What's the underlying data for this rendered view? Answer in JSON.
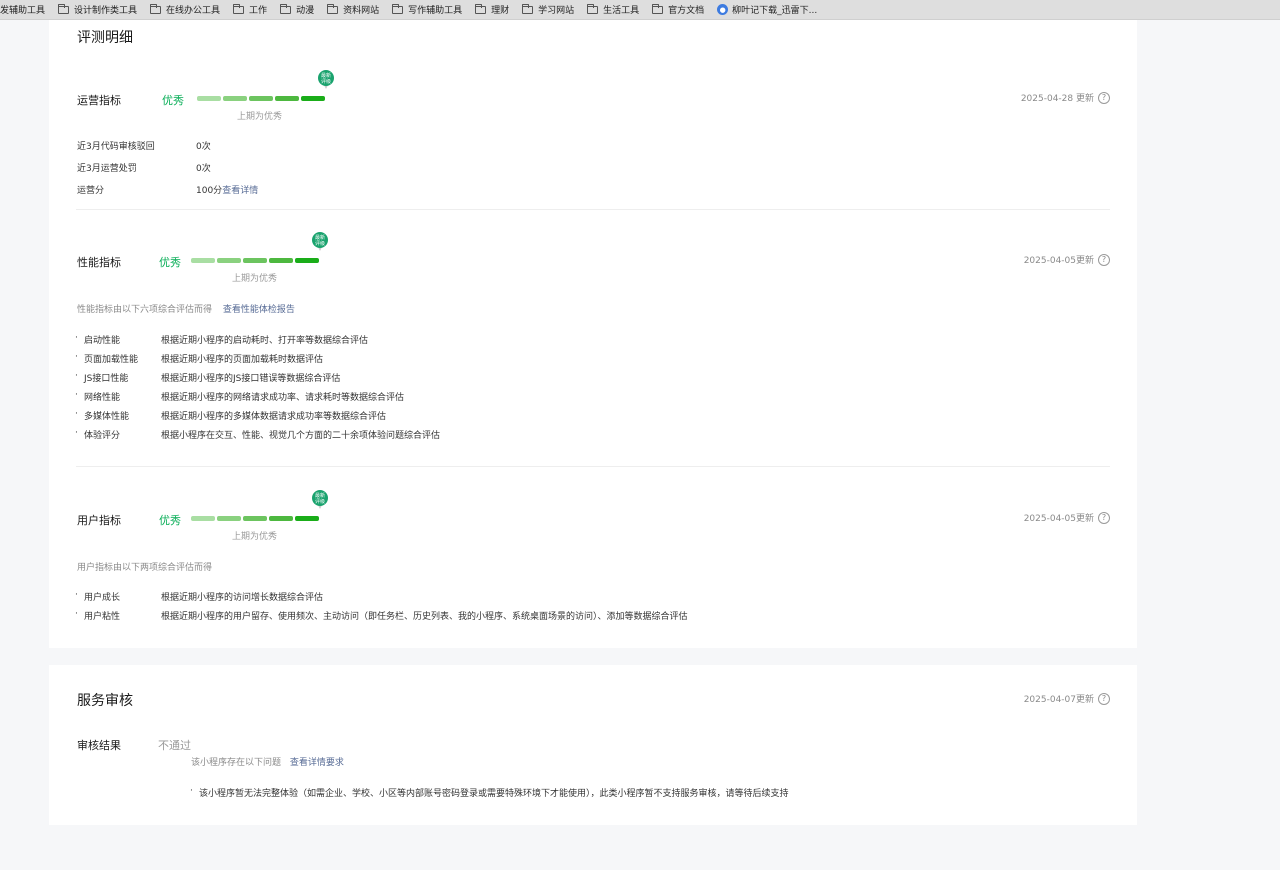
{
  "bookmarks": [
    {
      "label": "发辅助工具",
      "icon": "none"
    },
    {
      "label": "设计制作类工具",
      "icon": "folder-icon"
    },
    {
      "label": "在线办公工具",
      "icon": "folder-icon"
    },
    {
      "label": "工作",
      "icon": "folder-icon"
    },
    {
      "label": "动漫",
      "icon": "folder-icon"
    },
    {
      "label": "资料网站",
      "icon": "folder-icon"
    },
    {
      "label": "写作辅助工具",
      "icon": "folder-icon"
    },
    {
      "label": "理财",
      "icon": "folder-icon"
    },
    {
      "label": "学习网站",
      "icon": "folder-icon"
    },
    {
      "label": "生活工具",
      "icon": "folder-icon"
    },
    {
      "label": "官方文档",
      "icon": "folder-icon"
    },
    {
      "label": "柳叶记下载_迅雷下...",
      "icon": "site-icon"
    }
  ],
  "evaluation": {
    "title": "评测明细",
    "operations": {
      "label": "运营指标",
      "grade": "优秀",
      "progress_level": 5,
      "progress_max": 5,
      "previous": "上期为优秀",
      "updated": "2025-04-28 更新",
      "rows": [
        {
          "key": "近3月代码审核驳回",
          "value": "0次"
        },
        {
          "key": "近3月运营处罚",
          "value": "0次"
        },
        {
          "key": "运营分",
          "value": "100分",
          "link": "查看详情"
        }
      ]
    },
    "performance": {
      "label": "性能指标",
      "grade": "优秀",
      "progress_level": 5,
      "progress_max": 5,
      "previous": "上期为优秀",
      "updated": "2025-04-05更新",
      "description": "性能指标由以下六项综合评估而得",
      "report_link": "查看性能体检报告",
      "items": [
        {
          "name": "启动性能",
          "desc": "根据近期小程序的启动耗时、打开率等数据综合评估"
        },
        {
          "name": "页面加载性能",
          "desc": "根据近期小程序的页面加载耗时数据评估"
        },
        {
          "name": "JS接口性能",
          "desc": "根据近期小程序的JS接口错误等数据综合评估"
        },
        {
          "name": "网络性能",
          "desc": "根据近期小程序的网络请求成功率、请求耗时等数据综合评估"
        },
        {
          "name": "多媒体性能",
          "desc": "根据近期小程序的多媒体数据请求成功率等数据综合评估"
        },
        {
          "name": "体验评分",
          "desc": "根据小程序在交互、性能、视觉几个方面的二十余项体验问题综合评估"
        }
      ]
    },
    "user": {
      "label": "用户指标",
      "grade": "优秀",
      "progress_level": 5,
      "progress_max": 5,
      "previous": "上期为优秀",
      "updated": "2025-04-05更新",
      "description": "用户指标由以下两项综合评估而得",
      "items": [
        {
          "name": "用户成长",
          "desc": "根据近期小程序的访问增长数据综合评估"
        },
        {
          "name": "用户粘性",
          "desc": "根据近期小程序的用户留存、使用频次、主动访问（即任务栏、历史列表、我的小程序、系统桌面场景的访问）、添加等数据综合评估"
        }
      ]
    }
  },
  "service_review": {
    "title": "服务审核",
    "updated": "2025-04-07更新",
    "result_label": "审核结果",
    "result_value": "不通过",
    "problem_text": "该小程序存在以下问题",
    "requirements_link": "查看详情要求",
    "issues": [
      "该小程序暂无法完整体验（如需企业、学校、小区等内部账号密码登录或需要特殊环境下才能使用），此类小程序暂不支持服务审核，请等待后续支持"
    ]
  },
  "badge_text": "最新\n评级",
  "colors": {
    "grade": "#06ad56",
    "link": "#576b95",
    "bar_segments": [
      "#a9dea3",
      "#8ad17f",
      "#6cc45f",
      "#4db83f",
      "#1aad19"
    ]
  }
}
